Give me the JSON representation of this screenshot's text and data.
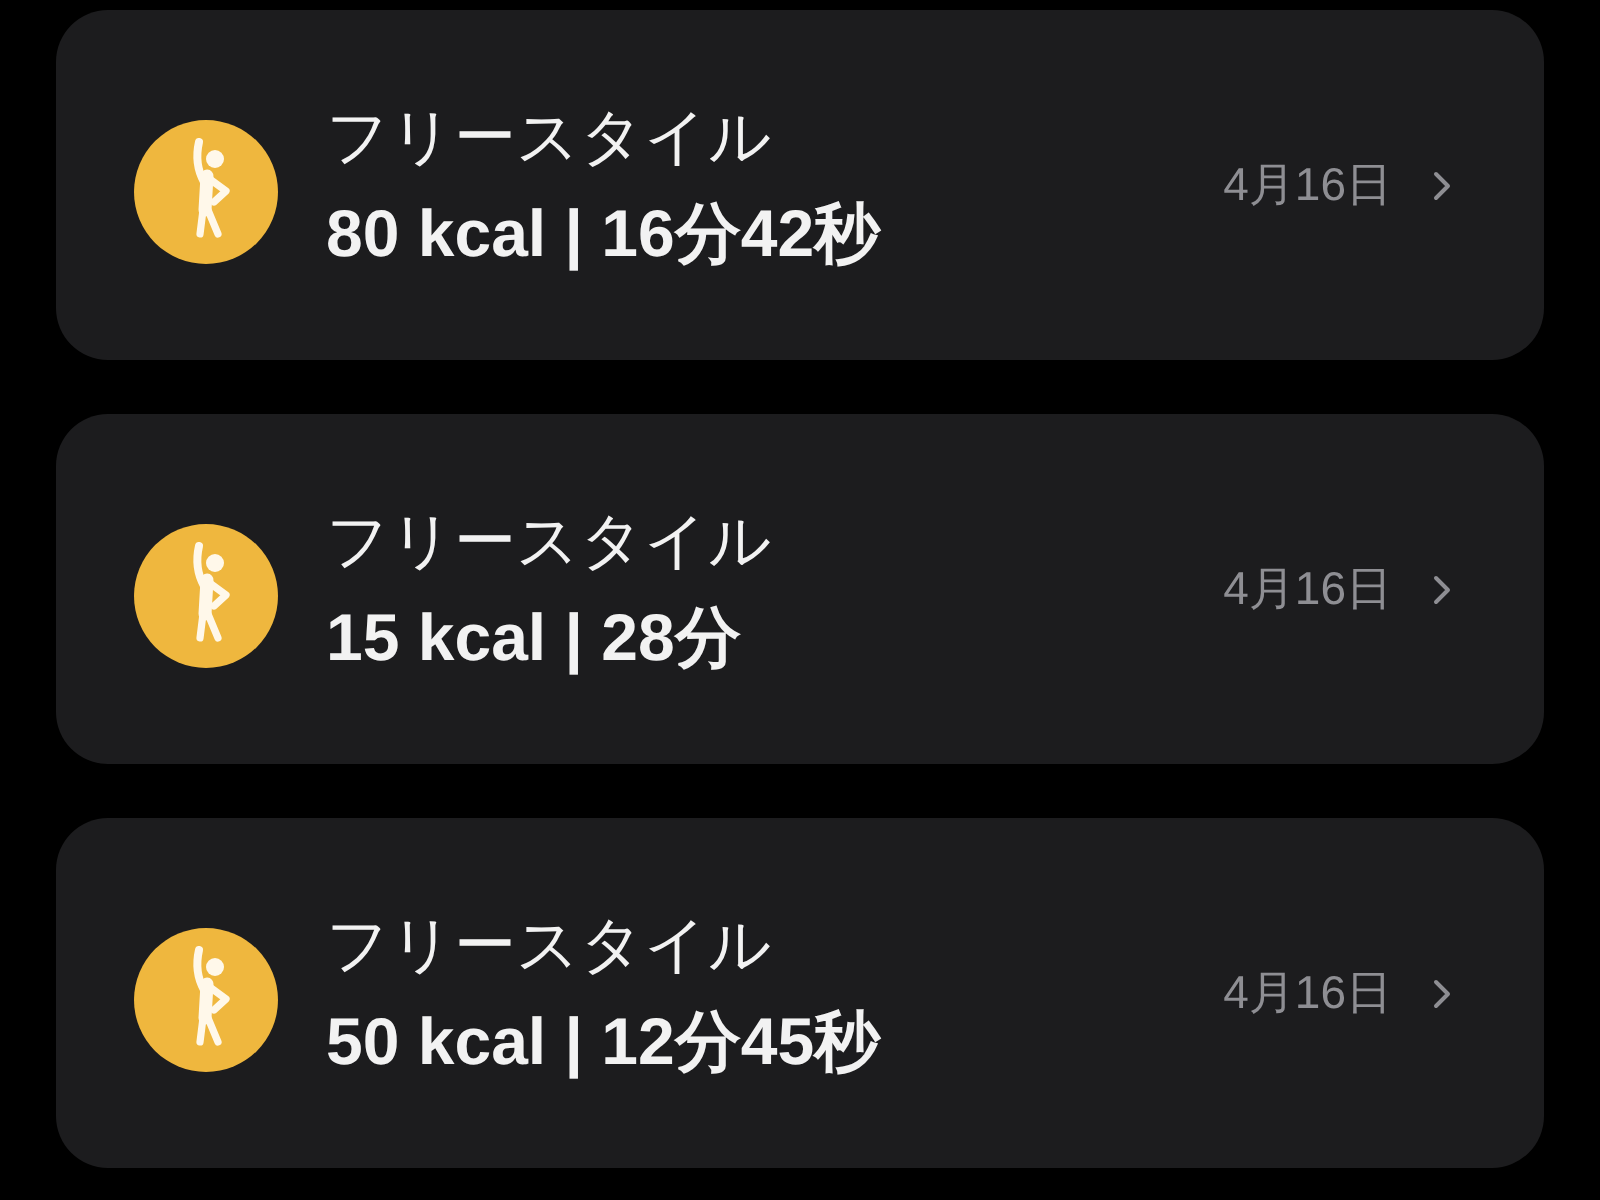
{
  "workouts": [
    {
      "title": "フリースタイル",
      "stats": "80 kcal | 16分42秒",
      "date": "4月16日"
    },
    {
      "title": "フリースタイル",
      "stats": "15 kcal | 28分",
      "date": "4月16日"
    },
    {
      "title": "フリースタイル",
      "stats": "50 kcal | 12分45秒",
      "date": "4月16日"
    }
  ]
}
